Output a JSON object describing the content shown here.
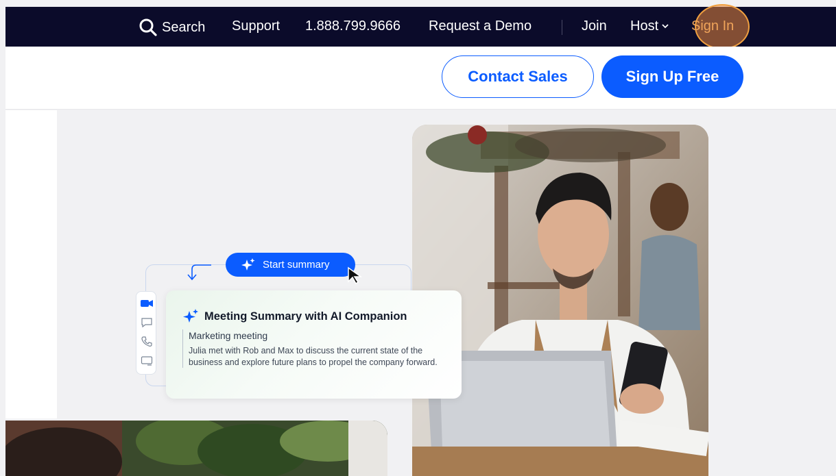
{
  "topnav": {
    "search_label": "Search",
    "support_label": "Support",
    "phone_label": "1.888.799.9666",
    "demo_label": "Request a Demo",
    "join_label": "Join",
    "host_label": "Host",
    "signin_label": "Sign In"
  },
  "header": {
    "contact_label": "Contact Sales",
    "signup_label": "Sign Up Free"
  },
  "widget": {
    "start_label": "Start summary",
    "card_title": "Meeting Summary with AI Companion",
    "card_subtitle": "Marketing meeting",
    "card_text": "Julia met with Rob and Max to discuss the current state of the business and explore future plans to propel the company forward.",
    "side_icons": [
      "video-icon",
      "chat-icon",
      "phone-icon",
      "screen-icon"
    ]
  },
  "colors": {
    "nav_bg": "#0b0b2a",
    "brand_blue": "#0b5cff",
    "signin_highlight": "#f0a45a"
  }
}
